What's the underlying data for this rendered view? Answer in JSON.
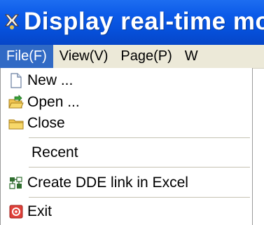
{
  "window": {
    "title": "Display real-time mo"
  },
  "menubar": {
    "items": [
      {
        "label": "File(F)"
      },
      {
        "label": "View(V)"
      },
      {
        "label": "Page(P)"
      },
      {
        "label": "W"
      }
    ]
  },
  "file_menu": {
    "items": [
      {
        "label": "New ...",
        "icon": "new-document-icon"
      },
      {
        "label": "Open ...",
        "icon": "open-folder-icon"
      },
      {
        "label": "Close",
        "icon": "close-folder-icon"
      },
      {
        "label": "Recent",
        "icon": ""
      },
      {
        "label": "Create DDE link in Excel",
        "icon": "dde-link-icon"
      },
      {
        "label": "Exit",
        "icon": "exit-icon"
      }
    ]
  },
  "colors": {
    "titlebar": "#0b5ae8",
    "menubar": "#ece9d8",
    "menu_highlight": "#316ac5"
  }
}
